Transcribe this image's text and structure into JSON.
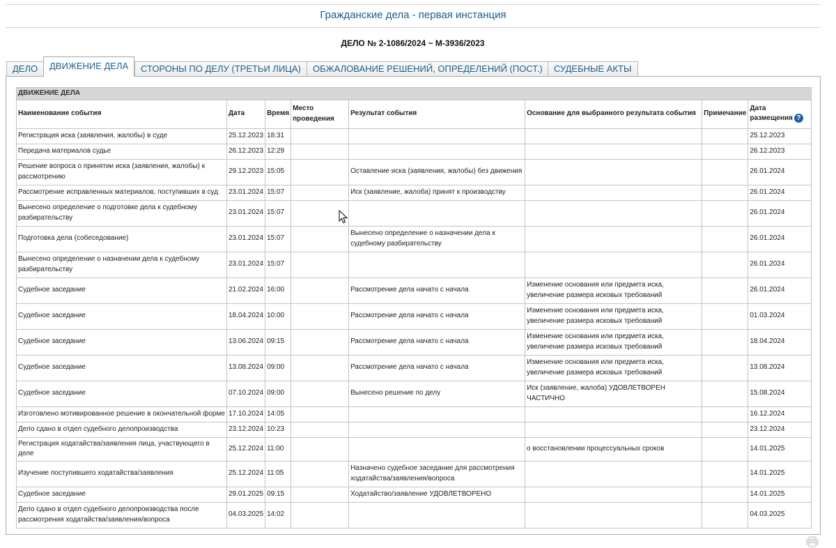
{
  "page_title": "Гражданские дела - первая инстанция",
  "case_number": "ДЕЛО № 2-1086/2024 ~ М-3936/2023",
  "tabs": [
    {
      "label": "ДЕЛО",
      "active": false
    },
    {
      "label": "ДВИЖЕНИЕ ДЕЛА",
      "active": true
    },
    {
      "label": "СТОРОНЫ ПО ДЕЛУ (ТРЕТЬИ ЛИЦА)",
      "active": false
    },
    {
      "label": "ОБЖАЛОВАНИЕ РЕШЕНИЙ, ОПРЕДЕЛЕНИЙ (ПОСТ.)",
      "active": false
    },
    {
      "label": "СУДЕБНЫЕ АКТЫ",
      "active": false
    }
  ],
  "table": {
    "caption": "ДВИЖЕНИЕ ДЕЛА",
    "headers": {
      "event": "Наименование события",
      "date": "Дата",
      "time": "Время",
      "place": "Место проведения",
      "result": "Результат события",
      "basis": "Основание для выбранного результата события",
      "note": "Примечание",
      "posted": "Дата размещения"
    },
    "rows": [
      {
        "event": "Регистрация иска (заявления, жалобы) в суде",
        "date": "25.12.2023",
        "time": "18:31",
        "place": "",
        "result": "",
        "basis": "",
        "note": "",
        "posted": "25.12.2023"
      },
      {
        "event": "Передача материалов судье",
        "date": "26.12.2023",
        "time": "12:29",
        "place": "",
        "result": "",
        "basis": "",
        "note": "",
        "posted": "26.12.2023"
      },
      {
        "event": "Решение вопроса о принятии иска (заявления, жалобы) к рассмотрению",
        "date": "29.12.2023",
        "time": "15:05",
        "place": "",
        "result": "Оставление иска (заявления, жалобы) без движения",
        "basis": "",
        "note": "",
        "posted": "26.01.2024"
      },
      {
        "event": "Рассмотрение исправленных материалов, поступивших в суд",
        "date": "23.01.2024",
        "time": "15:07",
        "place": "",
        "result": "Иск (заявление, жалоба) принят к производству",
        "basis": "",
        "note": "",
        "posted": "26.01.2024"
      },
      {
        "event": "Вынесено определение о подготовке дела к судебному разбирательству",
        "date": "23.01.2024",
        "time": "15:07",
        "place": "",
        "result": "",
        "basis": "",
        "note": "",
        "posted": "26.01.2024"
      },
      {
        "event": "Подготовка дела (собеседование)",
        "date": "23.01.2024",
        "time": "15:07",
        "place": "",
        "result": "Вынесено определение о назначении дела к судебному разбирательству",
        "basis": "",
        "note": "",
        "posted": "26.01.2024"
      },
      {
        "event": "Вынесено определение о назначении дела к судебному разбирательству",
        "date": "23.01.2024",
        "time": "15:07",
        "place": "",
        "result": "",
        "basis": "",
        "note": "",
        "posted": "26.01.2024"
      },
      {
        "event": "Судебное заседание",
        "date": "21.02.2024",
        "time": "16:00",
        "place": "",
        "result": "Рассмотрение дела начато с начала",
        "basis": "Изменение основания или предмета иска, увеличение размера исковых требований",
        "note": "",
        "posted": "26.01.2024"
      },
      {
        "event": "Судебное заседание",
        "date": "18.04.2024",
        "time": "10:00",
        "place": "",
        "result": "Рассмотрение дела начато с начала",
        "basis": "Изменение основания или предмета иска, увеличение размера исковых требований",
        "note": "",
        "posted": "01.03.2024"
      },
      {
        "event": "Судебное заседание",
        "date": "13.06.2024",
        "time": "09:15",
        "place": "",
        "result": "Рассмотрение дела начато с начала",
        "basis": "Изменение основания или предмета иска, увеличение размера исковых требований",
        "note": "",
        "posted": "18.04.2024"
      },
      {
        "event": "Судебное заседание",
        "date": "13.08.2024",
        "time": "09:00",
        "place": "",
        "result": "Рассмотрение дела начато с начала",
        "basis": "Изменение основания или предмета иска, увеличение размера исковых требований",
        "note": "",
        "posted": "13.08.2024"
      },
      {
        "event": "Судебное заседание",
        "date": "07.10.2024",
        "time": "09:00",
        "place": "",
        "result": "Вынесено решение по делу",
        "basis": "Иск (заявление, жалоба) УДОВЛЕТВОРЕН ЧАСТИЧНО",
        "note": "",
        "posted": "15.08.2024"
      },
      {
        "event": "Изготовлено мотивированное решение в окончательной форме",
        "date": "17.10.2024",
        "time": "14:05",
        "place": "",
        "result": "",
        "basis": "",
        "note": "",
        "posted": "16.12.2024"
      },
      {
        "event": "Дело сдано в отдел судебного делопроизводства",
        "date": "23.12.2024",
        "time": "10:23",
        "place": "",
        "result": "",
        "basis": "",
        "note": "",
        "posted": "23.12.2024"
      },
      {
        "event": "Регистрация ходатайства/заявления лица, участвующего в деле",
        "date": "25.12.2024",
        "time": "11:00",
        "place": "",
        "result": "",
        "basis": "о восстановлении процессуальных сроков",
        "note": "",
        "posted": "14.01.2025"
      },
      {
        "event": "Изучение поступившего ходатайства/заявления",
        "date": "25.12.2024",
        "time": "11:05",
        "place": "",
        "result": "Назначено судебное заседание для рассмотрения ходатайства/заявления/вопроса",
        "basis": "",
        "note": "",
        "posted": "14.01.2025"
      },
      {
        "event": "Судебное заседание",
        "date": "29.01.2025",
        "time": "09:15",
        "place": "",
        "result": "Ходатайство/заявление УДОВЛЕТВОРЕНО",
        "basis": "",
        "note": "",
        "posted": "14.01.2025"
      },
      {
        "event": "Дело сдано в отдел судебного делопроизводства после рассмотрения ходатайства/заявления/вопроса",
        "date": "04.03.2025",
        "time": "14:02",
        "place": "",
        "result": "",
        "basis": "",
        "note": "",
        "posted": "04.03.2025"
      }
    ]
  },
  "icons": {
    "help": "question-circle-icon",
    "help_glyph": "?",
    "print": "printer-icon",
    "cursor": "mouse-pointer-icon"
  },
  "colors": {
    "header_text": "#1a5d8a",
    "tab_text": "#1d5f8c",
    "caption_bg": "#d6d6d6",
    "help_icon": "#1f5fa8"
  }
}
